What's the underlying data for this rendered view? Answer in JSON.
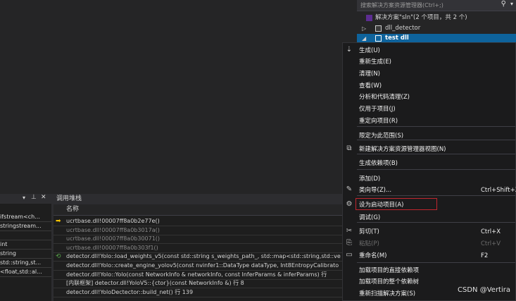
{
  "solution_explorer": {
    "search_placeholder": "搜索解决方案资源管理器(Ctrl+;)",
    "search_icon": "search-icon",
    "items": [
      {
        "label": "解决方案\"sln\"(2 个项目，共 2 个)",
        "icon": "solution-icon"
      },
      {
        "label": "dll_detector",
        "icon": "project-icon"
      },
      {
        "label": "test dll",
        "icon": "project-icon"
      }
    ]
  },
  "left_panel": {
    "rows": [
      "ifstream<ch...",
      "stringstream...",
      "",
      "int",
      "string",
      "std::string,st...",
      "<float,std::al..."
    ]
  },
  "call_stack": {
    "title": "调用堆栈",
    "col_name": "名称",
    "rows": [
      {
        "text": "ucrtbase.dll!00007ff8a0b2e77e()",
        "marker": "arrow",
        "dim": false
      },
      {
        "text": "ucrtbase.dll!00007ff8a0b3017a()",
        "marker": "",
        "dim": true
      },
      {
        "text": "ucrtbase.dll!00007ff8a0b30071()",
        "marker": "",
        "dim": true
      },
      {
        "text": "ucrtbase.dll!00007ff8a0b303f1()",
        "marker": "",
        "dim": true
      },
      {
        "text": "detector.dll!Yolo::load_weights_v5(const std::string s_weights_path_, std::map<std::string,std::ve",
        "marker": "green",
        "dim": false
      },
      {
        "text": "detector.dll!Yolo::create_engine_yolov5(const nvinfer1::DataType dataType, Int8EntropyCalibrato",
        "marker": "",
        "dim": false
      },
      {
        "text": "detector.dll!Yolo::Yolo(const NetworkInfo & networkInfo, const InferParams & inferParams) 行 ",
        "marker": "",
        "dim": false
      },
      {
        "text": "[内联框架] detector.dll!YoloV5::{ctor}(const NetworkInfo &) 行 8",
        "marker": "",
        "dim": false
      },
      {
        "text": "detector.dll!YoloDectector::build_net() 行 139",
        "marker": "",
        "dim": false
      }
    ]
  },
  "context_menu": {
    "items": [
      {
        "label": "生成(U)",
        "shortcut": "",
        "icon": "build-icon",
        "disabled": false
      },
      {
        "label": "重新生成(E)",
        "shortcut": "",
        "icon": "",
        "disabled": false
      },
      {
        "label": "清理(N)",
        "shortcut": "",
        "icon": "",
        "disabled": false
      },
      {
        "label": "查看(W)",
        "shortcut": "",
        "icon": "",
        "disabled": false
      },
      {
        "label": "分析和代码清理(Z)",
        "shortcut": "",
        "icon": "",
        "disabled": false
      },
      {
        "label": "仅用于项目(J)",
        "shortcut": "",
        "icon": "",
        "disabled": false
      },
      {
        "label": "重定向项目(R)",
        "shortcut": "",
        "icon": "",
        "disabled": false
      },
      {
        "label": "限定为此范围(S)",
        "shortcut": "",
        "icon": "",
        "disabled": false
      },
      {
        "label": "新建解决方案资源管理器视图(N)",
        "shortcut": "",
        "icon": "new-view-icon",
        "disabled": false
      },
      {
        "label": "生成依赖项(B)",
        "shortcut": "",
        "icon": "",
        "disabled": false
      },
      {
        "label": "添加(D)",
        "shortcut": "",
        "icon": "",
        "disabled": false
      },
      {
        "label": "类向导(Z)...",
        "shortcut": "Ctrl+Shift+X",
        "icon": "class-wizard-icon",
        "disabled": false
      },
      {
        "label": "设为启动项目(A)",
        "shortcut": "",
        "icon": "gear-icon",
        "disabled": false
      },
      {
        "label": "调试(G)",
        "shortcut": "",
        "icon": "",
        "disabled": false
      },
      {
        "label": "剪切(T)",
        "shortcut": "Ctrl+X",
        "icon": "cut-icon",
        "disabled": false
      },
      {
        "label": "粘贴(P)",
        "shortcut": "Ctrl+V",
        "icon": "paste-icon",
        "disabled": true
      },
      {
        "label": "重命名(M)",
        "shortcut": "F2",
        "icon": "rename-icon",
        "disabled": false
      },
      {
        "label": "加载项目的直接依赖项",
        "shortcut": "",
        "icon": "",
        "disabled": false
      },
      {
        "label": "加载项目的整个依赖树",
        "shortcut": "",
        "icon": "",
        "disabled": false
      },
      {
        "label": "重新扫描解决方案(S)",
        "shortcut": "",
        "icon": "",
        "disabled": false
      }
    ]
  },
  "watermark": "CSDN @Vertira",
  "colors": {
    "highlight_border": "#c0262e",
    "selected_row": "#0e639c"
  }
}
